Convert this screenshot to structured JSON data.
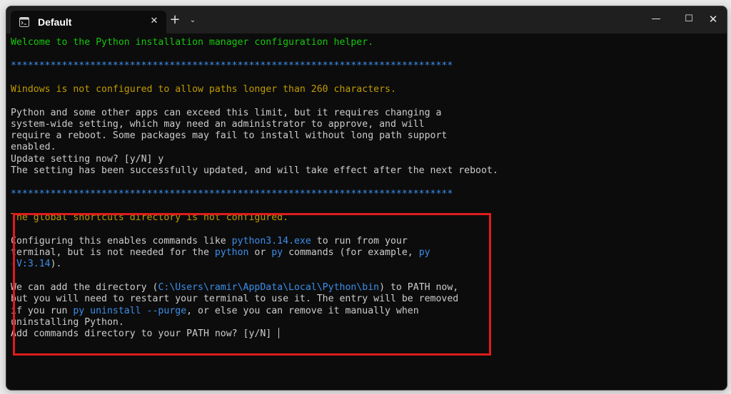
{
  "window": {
    "tab_title": "Default",
    "tab_icon": "terminal-icon",
    "close_tab_symbol": "✕",
    "new_tab_symbol": "+",
    "dropdown_symbol": "⌄",
    "minimize_symbol": "—",
    "maximize_symbol": "☐",
    "close_symbol": "✕"
  },
  "terminal": {
    "welcome": "Welcome to the Python installation manager configuration helper.",
    "separator": "******************************************************************************",
    "long_paths_heading": "Windows is not configured to allow paths longer than 260 characters.",
    "long_paths_body": [
      "Python and some other apps can exceed this limit, but it requires changing a",
      "system-wide setting, which may need an administrator to approve, and will",
      "require a reboot. Some packages may fail to install without long path support",
      "enabled."
    ],
    "update_prompt": "Update setting now? [y/N] y",
    "update_result": "The setting has been successfully updated, and will take effect after the next reboot.",
    "shortcuts_heading": "The global shortcuts directory is not configured.",
    "shortcuts_line1_a": "Configuring this enables commands like ",
    "shortcuts_line1_b": "python3.14.exe",
    "shortcuts_line1_c": " to run from your",
    "shortcuts_line2_a": "terminal, but is not needed for the ",
    "shortcuts_line2_b": "python",
    "shortcuts_line2_c": " or ",
    "shortcuts_line2_d": "py",
    "shortcuts_line2_e": " commands (for example, ",
    "shortcuts_line2_f": "py",
    "shortcuts_line3_a": "-V:3.14",
    "shortcuts_line3_b": ").",
    "path_line1_a": "We can add the directory (",
    "path_line1_b": "C:\\Users\\ramir\\AppData\\Local\\Python\\bin",
    "path_line1_c": ") to PATH now,",
    "path_line2": "but you will need to restart your terminal to use it. The entry will be removed",
    "path_line3_a": "if you run ",
    "path_line3_b": "py uninstall --purge",
    "path_line3_c": ", or else you can remove it manually when",
    "path_line4": "uninstalling Python.",
    "path_prompt": "Add commands directory to your PATH now? [y/N] "
  },
  "colors": {
    "green": "#16c60c",
    "yellow": "#c19c00",
    "blue": "#3b8eea",
    "text": "#cccccc",
    "highlight": "#e01b1b"
  }
}
